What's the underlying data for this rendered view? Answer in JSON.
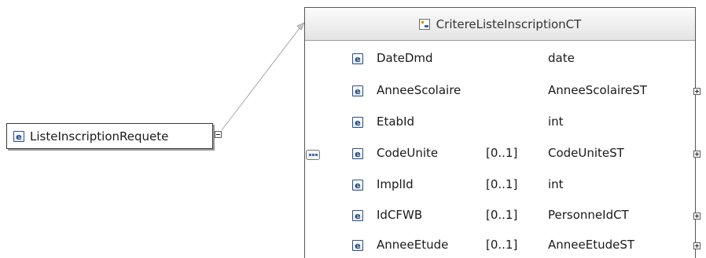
{
  "root_element": {
    "icon": "e",
    "name": "ListeInscriptionRequete"
  },
  "complex_type": {
    "name": "CritereListeInscriptionCT",
    "compositor": "sequence",
    "elements": [
      {
        "icon": "e",
        "name": "DateDmd",
        "occurs": "",
        "type": "date",
        "expandable": false
      },
      {
        "icon": "e",
        "name": "AnneeScolaire",
        "occurs": "",
        "type": "AnneeScolaireST",
        "expandable": true
      },
      {
        "icon": "e",
        "name": "EtabId",
        "occurs": "",
        "type": "int",
        "expandable": false
      },
      {
        "icon": "e",
        "name": "CodeUnite",
        "occurs": "[0..1]",
        "type": "CodeUniteST",
        "expandable": true
      },
      {
        "icon": "e",
        "name": "ImplId",
        "occurs": "[0..1]",
        "type": "int",
        "expandable": false
      },
      {
        "icon": "e",
        "name": "IdCFWB",
        "occurs": "[0..1]",
        "type": "PersonneIdCT",
        "expandable": true
      },
      {
        "icon": "e",
        "name": "AnneeEtude",
        "occurs": "[0..1]",
        "type": "AnneeEtudeST",
        "expandable": true
      }
    ]
  },
  "colors": {
    "element_icon": "#1f3f77",
    "border": "#555555",
    "connector": "#9a9a9a"
  }
}
